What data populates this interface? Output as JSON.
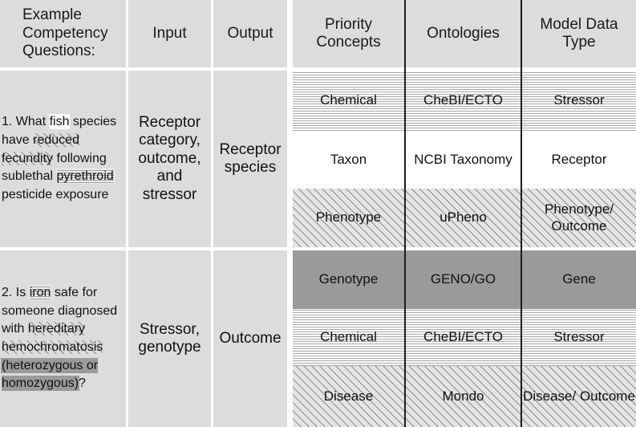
{
  "table": {
    "headers": [
      {
        "label": "Example Competency Questions:"
      },
      {
        "label": "Input"
      },
      {
        "label": "Output"
      },
      {
        "label": "Priority Concepts"
      },
      {
        "label": "Ontologies"
      },
      {
        "label": "Model Data Type"
      }
    ],
    "questions": [
      {
        "number": "1.",
        "text_segments": [
          {
            "text": "1. What ",
            "highlight": "none"
          },
          {
            "text": "fish",
            "highlight": "white"
          },
          {
            "text": " species have ",
            "highlight": "none"
          },
          {
            "text": "reduced fecundity",
            "highlight": "hatch"
          },
          {
            "text": " following sublethal ",
            "highlight": "none"
          },
          {
            "text": "pyrethroid",
            "highlight": "dots"
          },
          {
            "text": " pesticide exposure",
            "highlight": "none"
          }
        ],
        "plain_text": "1. What fish species have reduced fecundity following sublethal pyrethroid pesticide exposure",
        "input": "Receptor category, outcome, and stressor",
        "output": "Receptor species",
        "rows": [
          {
            "priority_concept": "Chemical",
            "ontology": "CheBI/ECTO",
            "model_data_type": "Stressor",
            "pattern": "dots"
          },
          {
            "priority_concept": "Taxon",
            "ontology": "NCBI Taxonomy",
            "model_data_type": "Receptor",
            "pattern": "white"
          },
          {
            "priority_concept": "Phenotype",
            "ontology": "uPheno",
            "model_data_type": "Phenotype/ Outcome",
            "pattern": "hatch"
          }
        ]
      },
      {
        "number": "2.",
        "text_segments": [
          {
            "text": "2. Is ",
            "highlight": "none"
          },
          {
            "text": "iron",
            "highlight": "dots"
          },
          {
            "text": " safe for someone diagnosed with ",
            "highlight": "none"
          },
          {
            "text": "hereditary hemochromatosis",
            "highlight": "hatch"
          },
          {
            "text": " ",
            "highlight": "none"
          },
          {
            "text": "(heterozygous or homozygous)",
            "highlight": "solid"
          },
          {
            "text": "?",
            "highlight": "none"
          }
        ],
        "plain_text": "2. Is iron safe for someone diagnosed with hereditary hemochromatosis (heterozygous or homozygous)?",
        "input": "Stressor, genotype",
        "output": "Outcome",
        "rows": [
          {
            "priority_concept": "Genotype",
            "ontology": "GENO/GO",
            "model_data_type": "Gene",
            "pattern": "solid"
          },
          {
            "priority_concept": "Chemical",
            "ontology": "CheBI/ECTO",
            "model_data_type": "Stressor",
            "pattern": "dots"
          },
          {
            "priority_concept": "Disease",
            "ontology": "Mondo",
            "model_data_type": "Disease/ Outcome",
            "pattern": "hatch"
          }
        ]
      }
    ]
  },
  "colors": {
    "header_background": "#dcdcdc",
    "cell_background": "#dcdcdc",
    "solid_highlight": "#9a9a9a",
    "hatch_background": "#e4e4e4",
    "dots_background": "#ffffff",
    "rule": "#1d1d1d",
    "text": "#111111"
  }
}
